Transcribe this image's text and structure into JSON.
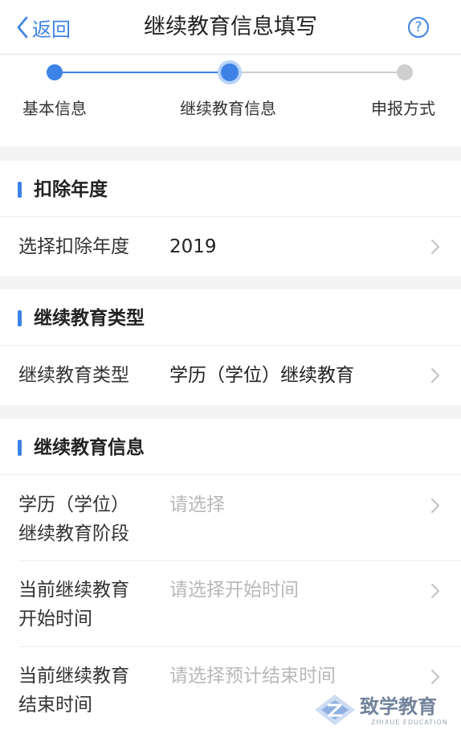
{
  "header": {
    "back_label": "返回",
    "title": "继续教育信息填写",
    "help_symbol": "?"
  },
  "steps": {
    "items": [
      {
        "label": "基本信息",
        "state": "done"
      },
      {
        "label": "继续教育信息",
        "state": "current"
      },
      {
        "label": "申报方式",
        "state": "pending"
      }
    ]
  },
  "sections": {
    "deduction_year": {
      "title": "扣除年度",
      "row": {
        "label": "选择扣除年度",
        "value": "2019"
      }
    },
    "education_type": {
      "title": "继续教育类型",
      "row": {
        "label": "继续教育类型",
        "value": "学历（学位）继续教育"
      }
    },
    "education_info": {
      "title": "继续教育信息",
      "rows": [
        {
          "label_line1": "学历（学位）",
          "label_line2": "继续教育阶段",
          "placeholder": "请选择"
        },
        {
          "label_line1": "当前继续教育",
          "label_line2": "开始时间",
          "placeholder": "请选择开始时间"
        },
        {
          "label_line1": "当前继续教育",
          "label_line2": "结束时间",
          "placeholder": "请选择预计结束时间"
        }
      ]
    }
  },
  "watermark": {
    "brand": "致学教育",
    "sub": "ZHIXUE EDUCATION"
  },
  "colors": {
    "accent": "#3d82e6",
    "accent_light": "#b7d3f8",
    "pending": "#cfcfcf",
    "placeholder": "#b8b8b8",
    "separator": "#f4f4f4"
  },
  "icons": {
    "back": "chevron-left-icon",
    "help": "question-circle-icon",
    "row_arrow": "chevron-right-icon",
    "watermark_logo": "zhixue-logo-icon"
  }
}
